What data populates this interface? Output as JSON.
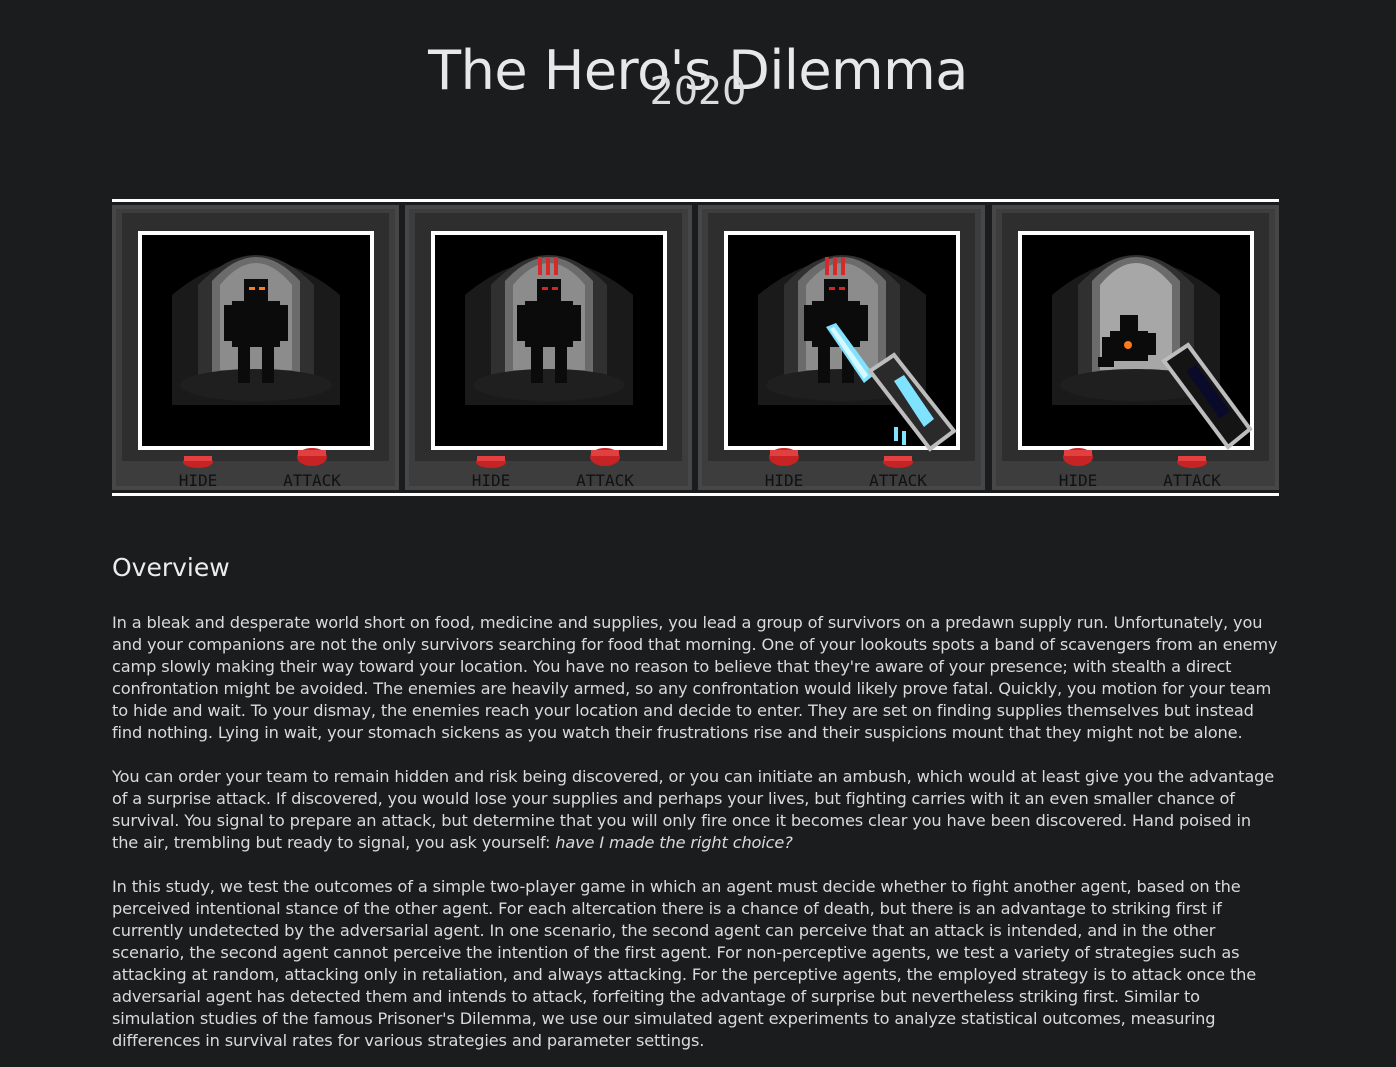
{
  "header": {
    "title": "The Hero's Dilemma",
    "year": "2020"
  },
  "game_panels": [
    {
      "hide_label": "HIDE",
      "attack_label": "ATTACK",
      "icon": "shadow-figure-idle"
    },
    {
      "hide_label": "HIDE",
      "attack_label": "ATTACK",
      "icon": "shadow-figure-alert"
    },
    {
      "hide_label": "HIDE",
      "attack_label": "ATTACK",
      "icon": "shadow-figure-alert-with-energy-blade"
    },
    {
      "hide_label": "HIDE",
      "attack_label": "ATTACK",
      "icon": "figure-hit-with-blaster"
    }
  ],
  "content": {
    "section_title": "Overview",
    "p1": "In a bleak and desperate world short on food, medicine and supplies, you lead a group of survivors on a predawn supply run. Unfortunately, you and your companions are not the only survivors searching for food that morning. One of your lookouts spots a band of scavengers from an enemy camp slowly making their way toward your location. You have no reason to believe that they're aware of your presence; with stealth a direct confrontation might be avoided. The enemies are heavily armed, so any confrontation would likely prove fatal. Quickly, you motion for your team to hide and wait. To your dismay, the enemies reach your location and decide to enter. They are set on finding supplies themselves but instead find nothing. Lying in wait, your stomach sickens as you watch their frustrations rise and their suspicions mount that they might not be alone.",
    "p2_main": "You can order your team to remain hidden and risk being discovered, or you can initiate an ambush, which would at least give you the advantage of a surprise attack. If discovered, you would lose your supplies and perhaps your lives, but fighting carries with it an even smaller chance of survival. You signal to prepare an attack, but determine that you will only fire once it becomes clear you have been discovered. Hand poised in the air, trembling but ready to signal, you ask yourself: ",
    "p2_emphasis": "have I made the right choice?",
    "p3": "In this study, we test the outcomes of a simple two-player game in which an agent must decide whether to fight another agent, based on the perceived intentional stance of the other agent. For each altercation there is a chance of death, but there is an advantage to striking first if currently undetected by the adversarial agent. In one scenario, the second agent can perceive that an attack is intended, and in the other scenario, the second agent cannot perceive the intention of the first agent. For non-perceptive agents, we test a variety of strategies such as attacking at random, attacking only in retaliation, and always attacking. For the perceptive agents, the employed strategy is to attack once the adversarial agent has detected them and intends to attack, forfeiting the advantage of surprise but nevertheless striking first. Similar to simulation studies of the famous Prisoner's Dilemma, we use our simulated agent experiments to analyze statistical outcomes, measuring differences in survival rates for various strategies and parameter settings."
  },
  "colors": {
    "background": "#1b1c1e",
    "text": "#dadada",
    "button_red": "#c62424",
    "blade_cyan": "#7fe3ff",
    "eye_orange": "#ff7a1a"
  }
}
